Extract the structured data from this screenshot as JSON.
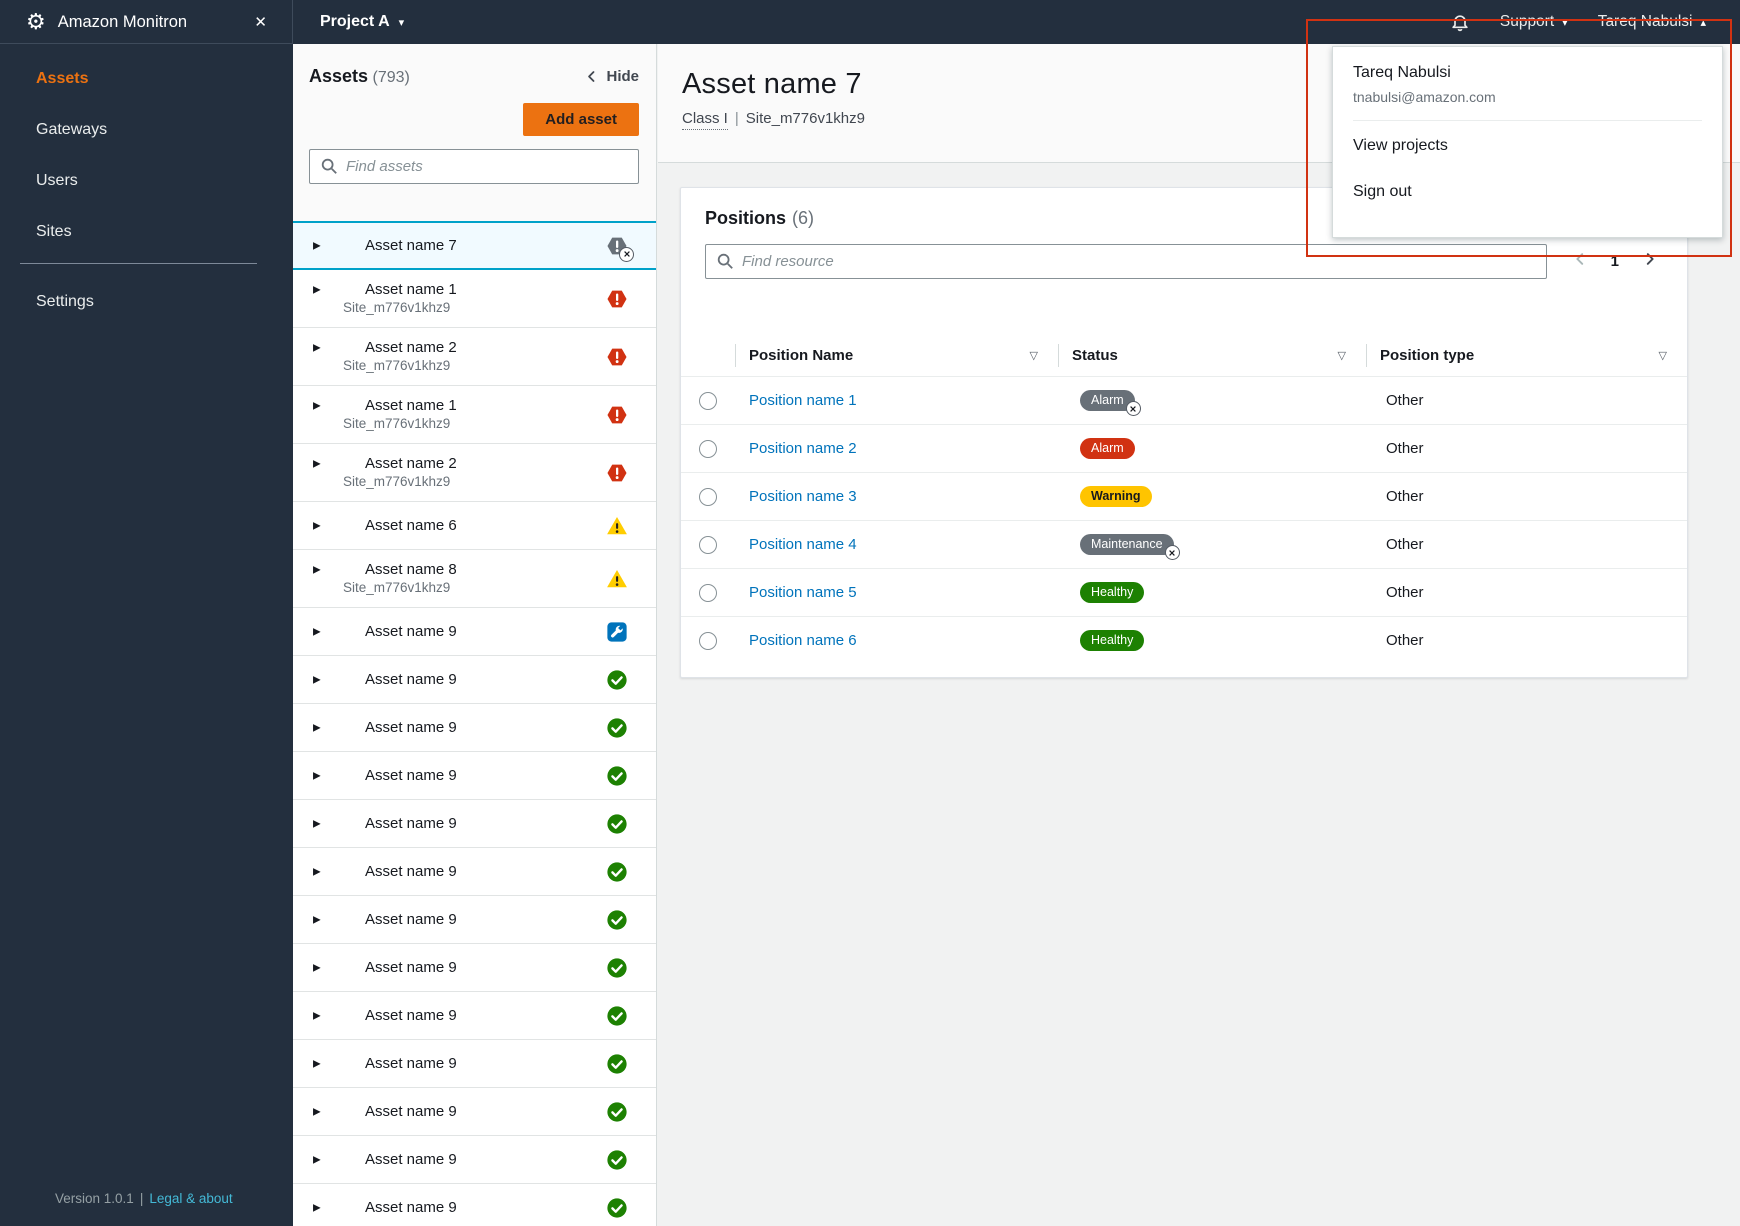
{
  "topbar": {
    "app_title": "Amazon Monitron",
    "project_label": "Project A",
    "support_label": "Support",
    "user_label": "Tareq Nabulsi"
  },
  "sidebar": {
    "items": [
      {
        "label": "Assets",
        "active": true
      },
      {
        "label": "Gateways",
        "active": false
      },
      {
        "label": "Users",
        "active": false
      },
      {
        "label": "Sites",
        "active": false
      },
      {
        "label": "Settings",
        "active": false,
        "divider_above": true
      }
    ],
    "version_text": "Version 1.0.1",
    "separator": "|",
    "legal_link": "Legal & about"
  },
  "assets_panel": {
    "title": "Assets",
    "count": "(793)",
    "hide_label": "Hide",
    "add_button_label": "Add asset",
    "search_placeholder": "Find assets",
    "items": [
      {
        "name": "Asset name 7",
        "site": "",
        "status": "alarm-muted",
        "selected": true
      },
      {
        "name": "Asset name 1",
        "site": "Site_m776v1khz9",
        "status": "alarm",
        "selected": false
      },
      {
        "name": "Asset name 2",
        "site": "Site_m776v1khz9",
        "status": "alarm",
        "selected": false
      },
      {
        "name": "Asset name 1",
        "site": "Site_m776v1khz9",
        "status": "alarm",
        "selected": false
      },
      {
        "name": "Asset name 2",
        "site": "Site_m776v1khz9",
        "status": "alarm",
        "selected": false
      },
      {
        "name": "Asset name 6",
        "site": "",
        "status": "warning",
        "selected": false
      },
      {
        "name": "Asset name 8",
        "site": "Site_m776v1khz9",
        "status": "warning",
        "selected": false
      },
      {
        "name": "Asset name 9",
        "site": "",
        "status": "maintenance",
        "selected": false
      },
      {
        "name": "Asset name 9",
        "site": "",
        "status": "healthy",
        "selected": false
      },
      {
        "name": "Asset name 9",
        "site": "",
        "status": "healthy",
        "selected": false
      },
      {
        "name": "Asset name 9",
        "site": "",
        "status": "healthy",
        "selected": false
      },
      {
        "name": "Asset name 9",
        "site": "",
        "status": "healthy",
        "selected": false
      },
      {
        "name": "Asset name 9",
        "site": "",
        "status": "healthy",
        "selected": false
      },
      {
        "name": "Asset name 9",
        "site": "",
        "status": "healthy",
        "selected": false
      },
      {
        "name": "Asset name 9",
        "site": "",
        "status": "healthy",
        "selected": false
      },
      {
        "name": "Asset name 9",
        "site": "",
        "status": "healthy",
        "selected": false
      },
      {
        "name": "Asset name 9",
        "site": "",
        "status": "healthy",
        "selected": false
      },
      {
        "name": "Asset name 9",
        "site": "",
        "status": "healthy",
        "selected": false
      },
      {
        "name": "Asset name 9",
        "site": "",
        "status": "healthy",
        "selected": false
      },
      {
        "name": "Asset name 9",
        "site": "",
        "status": "healthy",
        "selected": false
      }
    ]
  },
  "detail": {
    "title": "Asset name 7",
    "class_label": "Class I",
    "separator": "|",
    "site": "Site_m776v1khz9"
  },
  "positions": {
    "title": "Positions",
    "count": "(6)",
    "search_placeholder": "Find resource",
    "page": "1",
    "columns": [
      "Position Name",
      "Status",
      "Position type"
    ],
    "rows": [
      {
        "name": "Position name 1",
        "status": "Alarm",
        "variant": "muted",
        "muted": true,
        "type": "Other"
      },
      {
        "name": "Position name 2",
        "status": "Alarm",
        "variant": "alarm",
        "muted": false,
        "type": "Other"
      },
      {
        "name": "Position name 3",
        "status": "Warning",
        "variant": "warning",
        "muted": false,
        "type": "Other"
      },
      {
        "name": "Position name 4",
        "status": "Maintenance",
        "variant": "muted",
        "muted": true,
        "type": "Other"
      },
      {
        "name": "Position name 5",
        "status": "Healthy",
        "variant": "healthy",
        "muted": false,
        "type": "Other"
      },
      {
        "name": "Position name 6",
        "status": "Healthy",
        "variant": "healthy",
        "muted": false,
        "type": "Other"
      }
    ]
  },
  "user_menu": {
    "name": "Tareq Nabulsi",
    "email": "tnabulsi@amazon.com",
    "items": [
      "View projects",
      "Sign out"
    ]
  },
  "colors": {
    "topbar_navy": "#232f3e",
    "accent_orange": "#ec7211",
    "link_blue": "#0073bb",
    "selected_border": "#00a1c9",
    "selected_bg": "#f1faff",
    "alarm_red": "#d13212",
    "warning_yellow": "#ffc400",
    "healthy_green": "#1d8102",
    "muted_grey": "#687078",
    "maintenance_blue": "#0073bb",
    "annotation_red": "#d13212"
  }
}
